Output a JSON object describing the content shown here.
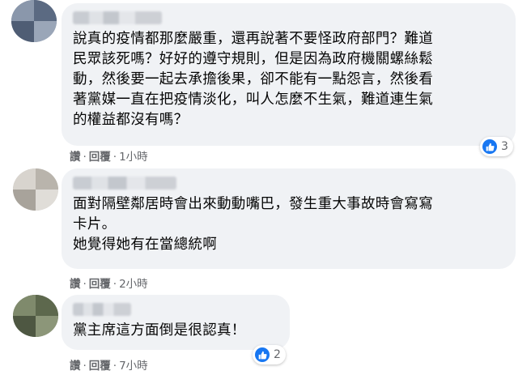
{
  "comments": [
    {
      "text": "說真的疫情都那麼嚴重，還再說著不要怪政府部門？難道\n民眾該死嗎？好好的遵守規則，但是因為政府機關螺絲鬆\n動，然後要一起去承擔後果，卻不能有一點怨言，然後看\n著黨媒一直在把疫情淡化，叫人怎麼不生氣，難道連生氣\n的權益都沒有嗎？",
      "like_label": "讚",
      "reply_label": "回覆",
      "time": "1小時",
      "reaction_count": "3"
    },
    {
      "text": "面對隔壁鄰居時會出來動動嘴巴，發生重大事故時會寫寫\n卡片。\n她覺得她有在當總統啊",
      "like_label": "讚",
      "reply_label": "回覆",
      "time": "2小時"
    },
    {
      "text": "黨主席這方面倒是很認真！",
      "like_label": "讚",
      "reply_label": "回覆",
      "time": "7小時",
      "reaction_count": "2"
    }
  ],
  "separator": "·",
  "colors": {
    "bubble_bg": "#f0f2f5",
    "meta_text": "#65676b",
    "like_blue": "#1877f2"
  },
  "icons": [
    "thumbs-up-icon"
  ]
}
